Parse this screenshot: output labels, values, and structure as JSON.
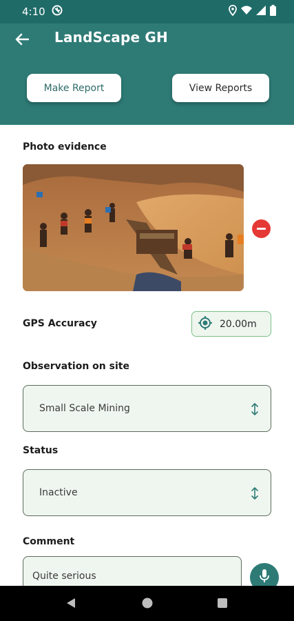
{
  "status_bar": {
    "time": "4:10",
    "icons": [
      "cast-icon",
      "location-icon",
      "wifi-icon",
      "signal-icon",
      "battery-icon"
    ]
  },
  "app_bar": {
    "title": "LandScape GH",
    "make_report_label": "Make Report",
    "view_reports_label": "View Reports",
    "color": "#2e7b76"
  },
  "photo_section": {
    "label": "Photo evidence"
  },
  "gps": {
    "label": "GPS Accuracy",
    "value": "20.00m"
  },
  "observation": {
    "label": "Observation on site",
    "value": "Small Scale Mining"
  },
  "status": {
    "label": "Status",
    "value": "Inactive"
  },
  "comment": {
    "label": "Comment",
    "value": "Quite serious"
  },
  "colors": {
    "accent": "#2e7b76",
    "danger": "#e53935",
    "field_bg": "#eff6ef"
  }
}
